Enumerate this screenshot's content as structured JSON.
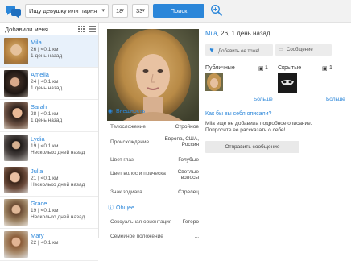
{
  "search": {
    "looking_for": "Ищу девушку или парня",
    "age_from": "18",
    "age_to": "33",
    "button": "Поиск"
  },
  "sidebar": {
    "title": "Добавили меня",
    "users": [
      {
        "name": "Mila",
        "info": "26 | <0.1 км",
        "time": "1 день назад"
      },
      {
        "name": "Amelia",
        "info": "24 | <0.1 км",
        "time": "1 день назад"
      },
      {
        "name": "Sarah",
        "info": "28 | <0.1 км",
        "time": "1 день назад"
      },
      {
        "name": "Lydia",
        "info": "19 | <0.1 км",
        "time": "Несколько дней назад"
      },
      {
        "name": "Julia",
        "info": "21 | <0.1 км",
        "time": "Несколько дней назад"
      },
      {
        "name": "Grace",
        "info": "19 | <0.1 км",
        "time": "Несколько дней назад"
      },
      {
        "name": "Mary",
        "info": "22 | <0.1 км",
        "time": ""
      }
    ]
  },
  "profile": {
    "name": "Mila",
    "summary": ", 26, 1 день назад",
    "appearance_title": "Внешность",
    "rows": [
      {
        "label": "Телосложение",
        "value": "Стройное"
      },
      {
        "label": "Происхождение",
        "value": "Европа, США, Россия"
      },
      {
        "label": "Цвет глаз",
        "value": "Голубые"
      },
      {
        "label": "Цвет волос и прическа",
        "value": "Светлые волосы"
      },
      {
        "label": "Знак зодиака",
        "value": "Стрелец"
      }
    ],
    "general_title": "Общее",
    "rows2": [
      {
        "label": "Сексуальная ориентация",
        "value": "Гетеро"
      },
      {
        "label": "Семейное положение",
        "value": "..."
      }
    ],
    "like_button": "Добавить ее тоже!",
    "message_button": "Сообщение",
    "public_label": "Публичные",
    "public_count": "1",
    "hidden_label": "Скрытые",
    "hidden_count": "1",
    "more1": "Больше",
    "more2": "Больше",
    "describe_link": "Как бы вы себя описали?",
    "no_desc": "Mila еще не добавила подробное описание. Попросите ее рассказать о себе!",
    "send_button": "Отправить сообщение"
  },
  "colors": {
    "accent": "#2b86d9",
    "topbar": "#f2f2f2",
    "selected": "#e8f1fb"
  }
}
